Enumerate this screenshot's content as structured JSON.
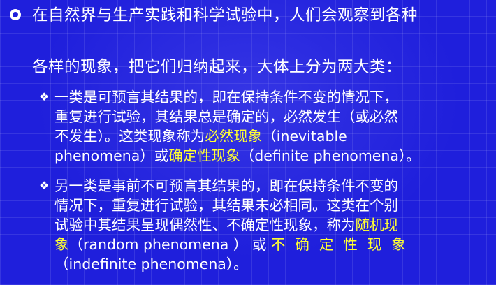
{
  "bullet_icon": "circle-bullet-icon",
  "sub_bullet_icon": "diamond-bullet-icon",
  "highlight_color": "#ffff33",
  "background_color": "#1f1fdc",
  "main": {
    "line1": "在自然界与生产实践和科学试验中，人们会观察到各种",
    "line2": "各样的现象，把它们归纳起来，大体上分为两大类："
  },
  "point1": {
    "line1": "一类是可预言其结果的，即在保持条件不变的情况下，",
    "line2": "重复进行试验，其结果总是确定的，必然发生（或必然",
    "line3_a": "不发生）。这类现象称为",
    "line3_hl": "必然现象",
    "line3_b": "（inevitable",
    "line4_a": "phenomena）或",
    "line4_hl": "确定性现象",
    "line4_b": "（definite  phenomena）。"
  },
  "point2": {
    "line1": "另一类是事前不可预言其结果的，即在保持条件不变的",
    "line2": "情况下，重复进行试验，其结果未必相同。这类在个别",
    "line3_a": "试验中其结果呈现偶然性、不确定性现象，称为",
    "line3_hl": "随机现",
    "line4_hl": "象",
    "line4_b": "（random phenomena ）  或 ",
    "line4_hl2": "不确定性现象",
    "line5": "（indefinite phenomena）。"
  }
}
